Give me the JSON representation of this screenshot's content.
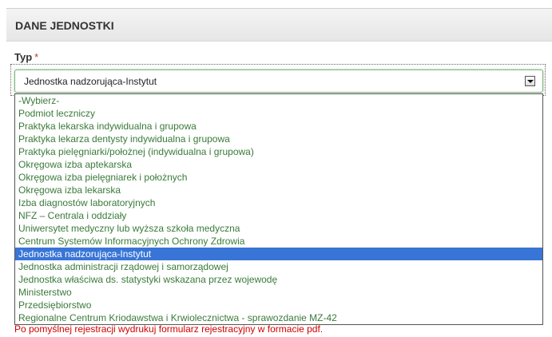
{
  "panel": {
    "title": "DANE JEDNOSTKI"
  },
  "field": {
    "label": "Typ",
    "required_mark": "*",
    "selected_value": "Jednostka nadzorująca-Instytut"
  },
  "dropdown": {
    "selected_index": 13,
    "options": [
      "-Wybierz-",
      "Podmiot leczniczy",
      "Praktyka lekarska indywidualna i grupowa",
      "Praktyka lekarza dentysty indywidualna i grupowa",
      "Praktyka pielęgniarki/położnej (indywidualna i grupowa)",
      "Okręgowa izba aptekarska",
      "Okręgowa izba pielęgniarek i położnych",
      "Okręgowa izba lekarska",
      "Izba diagnostów laboratoryjnych",
      "NFZ – Centrala i oddziały",
      "Uniwersytet medyczny lub wyższa szkoła medyczna",
      "Centrum Systemów Informacyjnych Ochrony Zdrowia",
      "Jednostka nadzorująca-Instytut",
      "Jednostka administracji rządowej i samorządowej",
      "Jednostka właściwa ds. statystyki wskazana przez wojewodę",
      "Ministerstwo",
      "Przedsiębiorstwo",
      "Regionalne Centrum Kriodawstwa i Krwiolecznictwa - sprawozdanie MZ-42"
    ]
  },
  "hint": "Po pomyślnej rejestracji wydrukuj formularz rejestracyjny w formacie pdf.",
  "colors": {
    "option_text": "#3a7a3a",
    "selected_bg": "#3875d7",
    "hint_text": "#d10000"
  }
}
